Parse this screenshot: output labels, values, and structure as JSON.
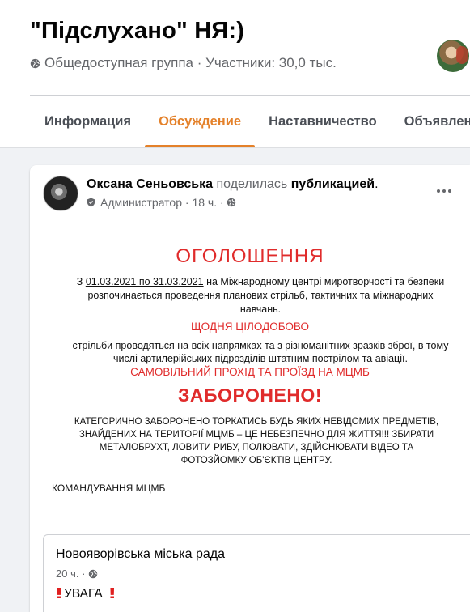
{
  "group": {
    "title": "\"Підслухано\" НЯ:)",
    "meta": "Общедоступная группа · Участники: 30,0 тыс."
  },
  "tabs": [
    "Информация",
    "Обсуждение",
    "Наставничество",
    "Объявления"
  ],
  "active_tab_index": 1,
  "colors": {
    "accent": "#e4812a",
    "notice_red": "#e02b2b",
    "muted": "#65676b"
  },
  "post": {
    "author": "Оксана Сеньовська",
    "verb": "поделилась",
    "object": "публикацией",
    "suffix": ".",
    "role": "Администратор",
    "time": "· 18 ч. ·",
    "notice": {
      "title": "ОГОЛОШЕННЯ",
      "p1_prefix": "З ",
      "p1_dates": "01.03.2021 по 31.03.2021",
      "p1_rest": " на Міжнародному центрі миротворчості та безпеки розпочинається проведення планових стрільб, тактичних та міжнародних навчань.",
      "daily": "ЩОДНЯ ЦІЛОДОБОВО",
      "p2": "стрільби проводяться на всіх напрямках та з різноманітних зразків зброї, в тому числі артилерійських підрозділів штатним пострілом та авіації.",
      "warn": "САМОВІЛЬНИЙ ПРОХІД ТА ПРОЇЗД НА МЦМБ",
      "forbidden": "ЗАБОРОНЕНО!",
      "caps": "КАТЕГОРИЧНО ЗАБОРОНЕНО ТОРКАТИСЬ БУДЬ ЯКИХ НЕВІДОМИХ ПРЕДМЕТІВ, ЗНАЙДЕНИХ НА ТЕРИТОРІЇ МЦМБ – ЦЕ НЕБЕЗПЕЧНО ДЛЯ ЖИТТЯ!!! ЗБИРАТИ МЕТАЛОБРУХТ, ЛОВИТИ РИБУ, ПОЛЮВАТИ, ЗДІЙСНЮВАТИ ВІДЕО ТА ФОТОЗЙОМКУ ОБ'ЄКТІВ ЦЕНТРУ.",
      "command": "КОМАНДУВАННЯ МЦМБ"
    },
    "shared": {
      "name": "Новояворівська міська рада",
      "time": "20 ч. ·",
      "text": "УВАГА",
      "icon_left": "double-exclamation-icon",
      "icon_right": "double-exclamation-icon"
    }
  }
}
